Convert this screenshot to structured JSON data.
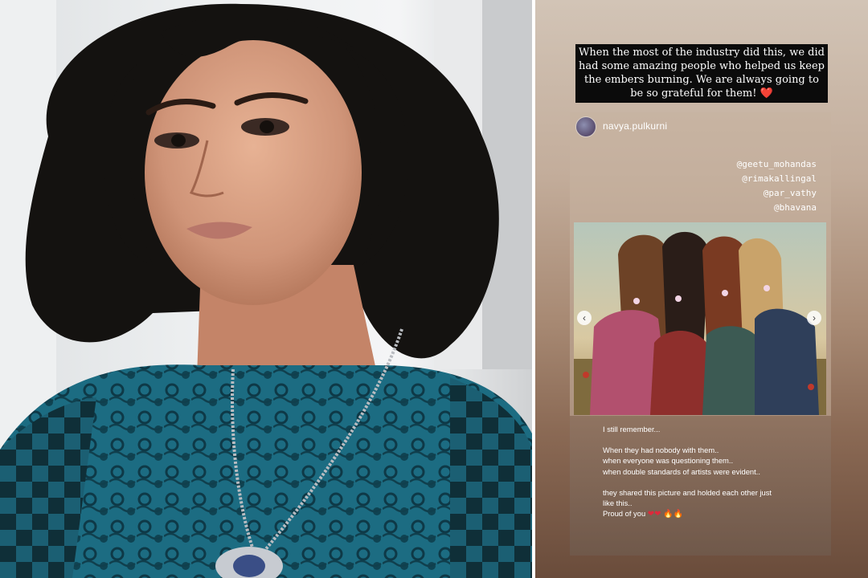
{
  "story": {
    "caption": "When the most of the industry did this, we did had some amazing people who helped us keep the embers burning. We are always going to be so grateful for them! ❤️",
    "username": "navya.pulkurni",
    "mentions": [
      "@geetu_mohandas",
      "@rimakallingal",
      "@par_vathy",
      "@bhavana"
    ],
    "nav": {
      "prev": "‹",
      "next": "›"
    },
    "text_lines": {
      "line1": "I still remember...",
      "line2": "When they had nobody with them..",
      "line3": "when everyone was questioning them..",
      "line4": "when  double standards of artists were evident..",
      "line5": "they shared this picture and holded each other just",
      "line6": "like this..",
      "line7": "Proud of you",
      "hearts": "❤❤",
      "flames": "🔥🔥"
    }
  },
  "colors": {
    "caption_bg": "#0b0b0b",
    "story_top": "#d2c4b6",
    "story_bottom": "#6a4c3b",
    "dress_teal": "#1f6f86",
    "hair": "#141210"
  }
}
